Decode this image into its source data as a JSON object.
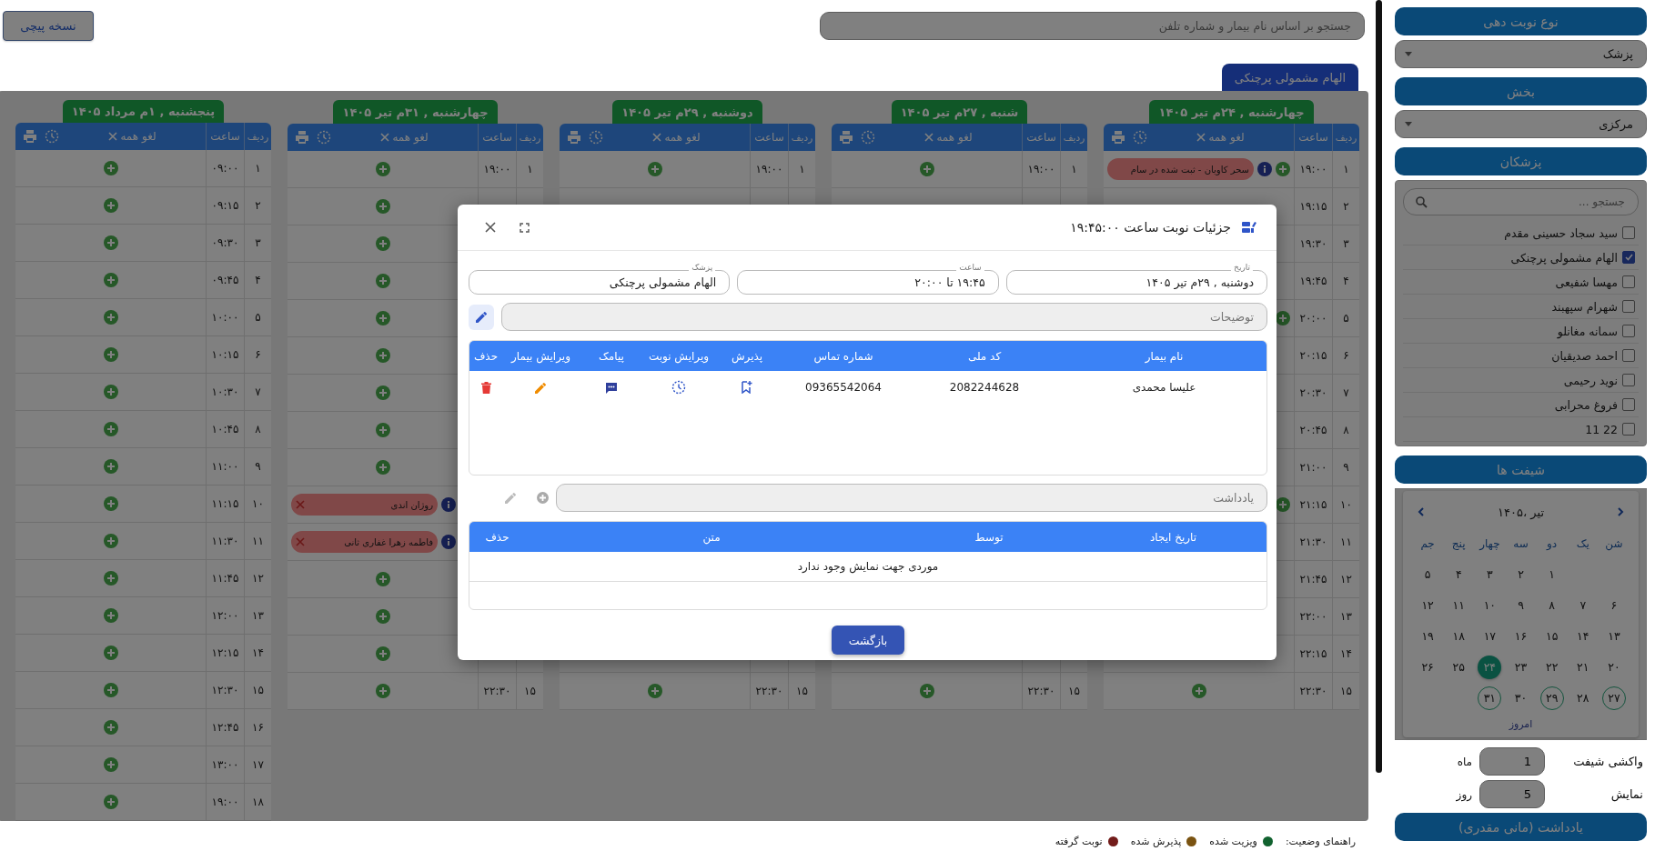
{
  "top_bar": {
    "prescription_button": "نسخه پیچی",
    "search": {
      "placeholder": "جستجو بر اساس نام بیمار و شماره تلفن"
    }
  },
  "doctor_tabs": [
    {
      "label": "الهام مشمولی پرچنکی",
      "selected": true
    }
  ],
  "days": [
    {
      "title": "چهارشنبه , ۲۴م تیر ۱۴۰۵",
      "row_header": "ردیف",
      "time_header": "ساعت",
      "cancel_all": "لغو همه",
      "rows": [
        {
          "num": "۱",
          "time": "۱۹:۰۰",
          "kind": "booked",
          "patient": "سحر کاویان - ثبت شده در سام",
          "cancel_icon": false
        },
        {
          "num": "۲",
          "time": "۱۹:۱۵",
          "kind": "covered"
        },
        {
          "num": "۳",
          "time": "۱۹:۳۰",
          "kind": "covered"
        },
        {
          "num": "۴",
          "time": "۱۹:۴۵",
          "kind": "covered"
        },
        {
          "num": "۵",
          "time": "۲۰:۰۰",
          "kind": "booked"
        },
        {
          "num": "۶",
          "time": "۲۰:۱۵",
          "kind": "covered"
        },
        {
          "num": "۷",
          "time": "۲۰:۳۰",
          "kind": "covered"
        },
        {
          "num": "۸",
          "time": "۲۰:۴۵",
          "kind": "covered"
        },
        {
          "num": "۹",
          "time": "۲۱:۰۰",
          "kind": "covered"
        },
        {
          "num": "۱۰",
          "time": "۲۱:۱۵",
          "kind": "booked"
        },
        {
          "num": "۱۱",
          "time": "۲۱:۳۰",
          "kind": "covered"
        },
        {
          "num": "۱۲",
          "time": "۲۱:۴۵",
          "kind": "covered"
        },
        {
          "num": "۱۳",
          "time": "۲۲:۰۰",
          "kind": "covered"
        },
        {
          "num": "۱۴",
          "time": "۲۲:۱۵",
          "kind": "covered"
        },
        {
          "num": "۱۵",
          "time": "۲۲:۳۰",
          "kind": "open"
        }
      ]
    },
    {
      "title": "شنبه , ۲۷م تیر ۱۴۰۵",
      "row_header": "ردیف",
      "time_header": "ساعت",
      "cancel_all": "لغو همه",
      "rows": [
        {
          "num": "۱",
          "time": "۱۹:۰۰",
          "kind": "open"
        },
        {
          "kind": "covered"
        },
        {
          "kind": "covered"
        },
        {
          "kind": "covered"
        },
        {
          "kind": "covered"
        },
        {
          "kind": "covered"
        },
        {
          "kind": "covered"
        },
        {
          "kind": "covered"
        },
        {
          "kind": "covered"
        },
        {
          "kind": "covered"
        },
        {
          "kind": "covered"
        },
        {
          "kind": "covered"
        },
        {
          "kind": "covered"
        },
        {
          "kind": "covered"
        },
        {
          "num": "۱۵",
          "time": "۲۲:۳۰",
          "kind": "open"
        }
      ]
    },
    {
      "title": "دوشنبه , ۲۹م تیر ۱۴۰۵",
      "row_header": "ردیف",
      "time_header": "ساعت",
      "cancel_all": "لغو همه",
      "rows": [
        {
          "num": "۱",
          "time": "۱۹:۰۰",
          "kind": "open"
        },
        {
          "kind": "covered"
        },
        {
          "kind": "covered"
        },
        {
          "kind": "covered"
        },
        {
          "kind": "covered"
        },
        {
          "kind": "covered"
        },
        {
          "kind": "covered"
        },
        {
          "kind": "covered"
        },
        {
          "kind": "covered"
        },
        {
          "kind": "covered"
        },
        {
          "kind": "covered"
        },
        {
          "kind": "covered"
        },
        {
          "kind": "covered"
        },
        {
          "kind": "covered"
        },
        {
          "num": "۱۵",
          "time": "۲۲:۳۰",
          "kind": "open"
        }
      ]
    },
    {
      "title": "چهارشنبه , ۳۱م تیر ۱۴۰۵",
      "row_header": "ردیف",
      "time_header": "ساعت",
      "cancel_all": "لغو همه",
      "rows": [
        {
          "num": "۱",
          "time": "۱۹:۰۰",
          "kind": "open"
        },
        {
          "kind": "open"
        },
        {
          "kind": "open"
        },
        {
          "kind": "open"
        },
        {
          "kind": "open"
        },
        {
          "kind": "open"
        },
        {
          "kind": "open"
        },
        {
          "kind": "open"
        },
        {
          "kind": "open"
        },
        {
          "kind": "booked",
          "patient": "روژان اندی",
          "cancel_icon": true
        },
        {
          "kind": "booked",
          "patient": "فاطمه زهرا غفاری ثانی",
          "cancel_icon": true
        },
        {
          "kind": "open"
        },
        {
          "kind": "open"
        },
        {
          "kind": "open"
        },
        {
          "num": "۱۵",
          "time": "۲۲:۳۰",
          "kind": "open"
        }
      ]
    },
    {
      "title": "پنجشنبه , ۱م مرداد ۱۴۰۵",
      "row_header": "ردیف",
      "time_header": "ساعت",
      "cancel_all": "لغو همه",
      "rows": [
        {
          "num": "۱",
          "time": "۰۹:۰۰",
          "kind": "open"
        },
        {
          "num": "۲",
          "time": "۰۹:۱۵",
          "kind": "open"
        },
        {
          "num": "۳",
          "time": "۰۹:۳۰",
          "kind": "open"
        },
        {
          "num": "۴",
          "time": "۰۹:۴۵",
          "kind": "open"
        },
        {
          "num": "۵",
          "time": "۱۰:۰۰",
          "kind": "open"
        },
        {
          "num": "۶",
          "time": "۱۰:۱۵",
          "kind": "open"
        },
        {
          "num": "۷",
          "time": "۱۰:۳۰",
          "kind": "open"
        },
        {
          "num": "۸",
          "time": "۱۰:۴۵",
          "kind": "open"
        },
        {
          "num": "۹",
          "time": "۱۱:۰۰",
          "kind": "open"
        },
        {
          "num": "۱۰",
          "time": "۱۱:۱۵",
          "kind": "open"
        },
        {
          "num": "۱۱",
          "time": "۱۱:۳۰",
          "kind": "open"
        },
        {
          "num": "۱۲",
          "time": "۱۱:۴۵",
          "kind": "open"
        },
        {
          "num": "۱۳",
          "time": "۱۲:۰۰",
          "kind": "open"
        },
        {
          "num": "۱۴",
          "time": "۱۲:۱۵",
          "kind": "open"
        },
        {
          "num": "۱۵",
          "time": "۱۲:۳۰",
          "kind": "open"
        },
        {
          "num": "۱۶",
          "time": "۱۲:۴۵",
          "kind": "open"
        },
        {
          "num": "۱۷",
          "time": "۱۳:۰۰",
          "kind": "open"
        },
        {
          "num": "۱۸",
          "time": "۱۹:۰۰",
          "kind": "open"
        }
      ]
    }
  ],
  "legend": {
    "title": "راهنمای وضعیت:",
    "items": [
      {
        "label": "ویزیت شده",
        "color": "#11622f"
      },
      {
        "label": "پذیرش شده",
        "color": "#7a5311"
      },
      {
        "label": "نوبت گرفته",
        "color": "#721c1a"
      }
    ]
  },
  "sidebar": {
    "booking_type": {
      "header": "نوع نوبت دهی",
      "value": "پزشک"
    },
    "department": {
      "header": "بخش",
      "value": "مرکزی"
    },
    "doctors_header": "پزشکان",
    "doctor_search": {
      "placeholder": "جستجو ..."
    },
    "doctors": [
      {
        "name": "سید سجاد حسینی مقدم",
        "checked": false
      },
      {
        "name": "الهام مشمولی پرچنکی",
        "checked": true
      },
      {
        "name": "مهسا شفیعی",
        "checked": false
      },
      {
        "name": "شهرام سپهبند",
        "checked": false
      },
      {
        "name": "سمانه مغانلو",
        "checked": false
      },
      {
        "name": "احمد صدیقیان",
        "checked": false
      },
      {
        "name": "نوید رحیمی",
        "checked": false
      },
      {
        "name": "فروغ محرابی",
        "checked": false
      },
      {
        "name": "22 11",
        "checked": false
      }
    ],
    "shifts_header": "شیفت ها",
    "calendar": {
      "month": "تیر ،۱۴۰۵",
      "weekdays": [
        "شن",
        "یک",
        "دو",
        "سه",
        "چهار",
        "پنج",
        "جم"
      ],
      "weeks": [
        {
          "kind": "offset",
          "days": [
            {
              "label": "۱",
              "selected": false,
              "has_shift": false
            },
            {
              "label": "۲",
              "selected": false,
              "has_shift": false
            },
            {
              "label": "۳",
              "selected": false,
              "has_shift": false
            },
            {
              "label": "۴",
              "selected": false,
              "has_shift": false
            },
            {
              "label": "۵",
              "selected": false,
              "has_shift": false
            }
          ]
        },
        {
          "kind": "full",
          "days": [
            {
              "label": "۶",
              "selected": false,
              "has_shift": false
            },
            {
              "label": "۷",
              "selected": false,
              "has_shift": false
            },
            {
              "label": "۸",
              "selected": false,
              "has_shift": false
            },
            {
              "label": "۹",
              "selected": false,
              "has_shift": false
            },
            {
              "label": "۱۰",
              "selected": false,
              "has_shift": false
            },
            {
              "label": "۱۱",
              "selected": false,
              "has_shift": false
            },
            {
              "label": "۱۲",
              "selected": false,
              "has_shift": false
            }
          ]
        },
        {
          "kind": "full",
          "days": [
            {
              "label": "۱۳",
              "selected": false,
              "has_shift": false
            },
            {
              "label": "۱۴",
              "selected": false,
              "has_shift": false
            },
            {
              "label": "۱۵",
              "selected": false,
              "has_shift": false
            },
            {
              "label": "۱۶",
              "selected": false,
              "has_shift": false
            },
            {
              "label": "۱۷",
              "selected": false,
              "has_shift": false
            },
            {
              "label": "۱۸",
              "selected": false,
              "has_shift": false
            },
            {
              "label": "۱۹",
              "selected": false,
              "has_shift": false
            }
          ]
        },
        {
          "kind": "full",
          "days": [
            {
              "label": "۲۰",
              "selected": false,
              "has_shift": false
            },
            {
              "label": "۲۱",
              "selected": false,
              "has_shift": false
            },
            {
              "label": "۲۲",
              "selected": false,
              "has_shift": false
            },
            {
              "label": "۲۳",
              "selected": false,
              "has_shift": false
            },
            {
              "label": "۲۴",
              "selected": true,
              "has_shift": true
            },
            {
              "label": "۲۵",
              "selected": false,
              "has_shift": false
            },
            {
              "label": "۲۶",
              "selected": false,
              "has_shift": false
            }
          ]
        },
        {
          "kind": "full",
          "days": [
            {
              "label": "۲۷",
              "selected": false,
              "has_shift": true
            },
            {
              "label": "۲۸",
              "selected": false,
              "has_shift": false
            },
            {
              "label": "۲۹",
              "selected": false,
              "has_shift": true
            },
            {
              "label": "۳۰",
              "selected": false,
              "has_shift": false
            },
            {
              "label": "۳۱",
              "selected": false,
              "has_shift": true
            }
          ]
        }
      ],
      "today_link": "امروز"
    },
    "fetch": {
      "label": "واکشی شیفت",
      "value": "1",
      "unit": "ماه"
    },
    "display": {
      "label": "نمایش",
      "value": "5",
      "unit": "روز"
    },
    "notes_header": "یادداشت (مانی مقدری)"
  },
  "modal": {
    "title": "جزئیات نوبت ساعت ۱۹:۴۵:۰۰",
    "fields": [
      {
        "label": "تاریخ",
        "value": "دوشنبه , ۲۹م تیر ۱۴۰۵"
      },
      {
        "label": "ساعت",
        "value": "۱۹:۴۵ تا ۲۰:۰۰"
      },
      {
        "label": "پزشک",
        "value": "الهام مشمولی پرچنکی"
      }
    ],
    "description": {
      "placeholder": "توضیحات"
    },
    "patients": {
      "columns": [
        "نام بیمار",
        "کد ملی",
        "شماره تماس",
        "پذیرش",
        "ویرایش نوبت",
        "پیامک",
        "ویرایش بیمار",
        "حذف"
      ],
      "rows": [
        {
          "name": "علیسا محمدی",
          "national_id": "2082244628",
          "phone": "09365542064"
        }
      ]
    },
    "note": {
      "placeholder": "یادداشت"
    },
    "notes": {
      "columns": [
        "تاریخ ایجاد",
        "توسط",
        "متن",
        "حذف"
      ],
      "empty_text": "موردی جهت نمایش وجود ندارد"
    },
    "back_button": "بازگشت"
  }
}
